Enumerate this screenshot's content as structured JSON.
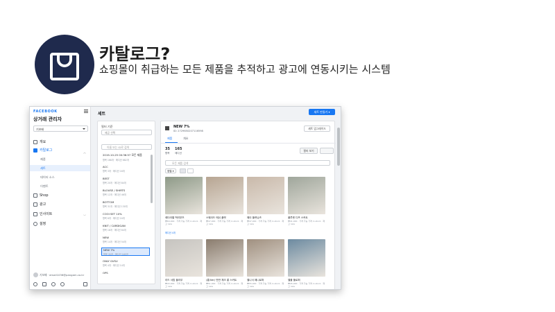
{
  "header": {
    "title": "카탈로그?",
    "subtitle": "쇼핑몰이 취급하는 모든 제품을 추적하고 광고에 연동시키는 시스템",
    "accent_color": "#1f2a4d",
    "icon": "shopping-bag-icon"
  },
  "screenshot": {
    "brand": "FACEBOOK",
    "app_title": "상거래 관리자",
    "catalog_select": "기보배",
    "nav": [
      {
        "label": "개요",
        "icon": "home-icon"
      },
      {
        "label": "카탈로그",
        "icon": "catalog-grid-icon",
        "active": true
      },
      {
        "label": "Shop",
        "icon": "shop-icon"
      },
      {
        "label": "광고",
        "icon": "megaphone-icon"
      },
      {
        "label": "인사이트",
        "icon": "chart-icon"
      },
      {
        "label": "설정",
        "icon": "gear-icon"
      }
    ],
    "nav_sub": [
      "제품",
      "세트",
      "데이터 소스",
      "이벤트"
    ],
    "user_email": "기보배 · email1036@pangam.co.kr",
    "page_title": "세트",
    "create_button": "세트 만들기 ▾",
    "filter": {
      "label": "필터 기준",
      "select_placeholder": "제공 선택",
      "search_placeholder": "이름 또는 ID로 검색"
    },
    "sets": [
      {
        "name": "2019-10-25 00:36:57 모든 제품",
        "sub": "항목 168개 · 에디션 682개"
      },
      {
        "name": "ACC",
        "sub": "항목 3개 · 에디션 16개"
      },
      {
        "name": "BEST",
        "sub": "항목 20개 · 에디션 84개"
      },
      {
        "name": "BLOUSE / SHIRTS",
        "sub": "항목 12개 · 에디션 46개"
      },
      {
        "name": "BOTTOM",
        "sub": "항목 31개 · 에디션 130개"
      },
      {
        "name": "COOI SET 10%",
        "sub": "항목 6개 · 에디션 24개"
      },
      {
        "name": "KNIT / CARDIGAN",
        "sub": "항목 18개 · 에디션 64개"
      },
      {
        "name": "NEW",
        "sub": "항목 14개 · 에디션 54개"
      },
      {
        "name": "NEW 7%",
        "sub": "항목 35개 · 에디션 165개",
        "selected": true
      },
      {
        "name": "ONLY GVSU",
        "sub": "항목 4개 · 에디션 14개"
      },
      {
        "name": "OPS",
        "sub": ""
      }
    ],
    "set_detail": {
      "name": "NEW 7%",
      "id": "ID: 2729650207116598",
      "settings_button": "세트 업그레이드",
      "tabs": [
        "제품",
        "개요"
      ],
      "item_count": "35",
      "item_label": "항목",
      "variant_count": "165",
      "variant_label": "에디션",
      "filter_button": "필터 보기",
      "edit_button": "카탈로그 세트 수정",
      "search_placeholder": "모든 제품 검색",
      "sort_label": "정렬 ▾"
    },
    "products": [
      {
        "name": "레더라벨 백리부츠",
        "meta": "₩64,900 · 가격 가능 가격 in stock · 재고 new",
        "link": "에디션 4개",
        "color": "#8e9a88"
      },
      {
        "name": "스웨이드 메쉬 플랫",
        "meta": "₩47,900 · 가격 가능 가격 in stock · 재고 new",
        "link": "",
        "color": "#b7a592"
      },
      {
        "name": "웨이 플랫슈즈",
        "meta": "₩47,900 · 가격 가능 가격 in stock · 재고 new",
        "link": "",
        "color": "#c9b9aa"
      },
      {
        "name": "플루랜 디프 스커트",
        "meta": "₩41,900 · 가격 가능 가격 in stock · 재고 new",
        "link": "",
        "color": "#9fa69b"
      },
      {
        "name": "리드 서랍 블라우",
        "meta": "₩43,900 · 가격 가능 가격 in stock · 재고 new",
        "link": "",
        "color": "#c6c4c0"
      },
      {
        "name": "(롱/Ver) 반반 체크 롱 스커트",
        "meta": "₩51,900 · 가격 가능 가격 in stock · 재고 new",
        "link": "",
        "color": "#8a7c6e"
      },
      {
        "name": "벨니서 페니로퍼",
        "meta": "₩55,900 · 가격 가능 가격 in stock · 재고 new",
        "link": "",
        "color": "#a09080"
      },
      {
        "name": "벨플 플로퍼",
        "meta": "₩45,900 · 가격 가능 가격 in stock · 재고 new",
        "link": "",
        "color": "#6c8aa0"
      }
    ]
  }
}
